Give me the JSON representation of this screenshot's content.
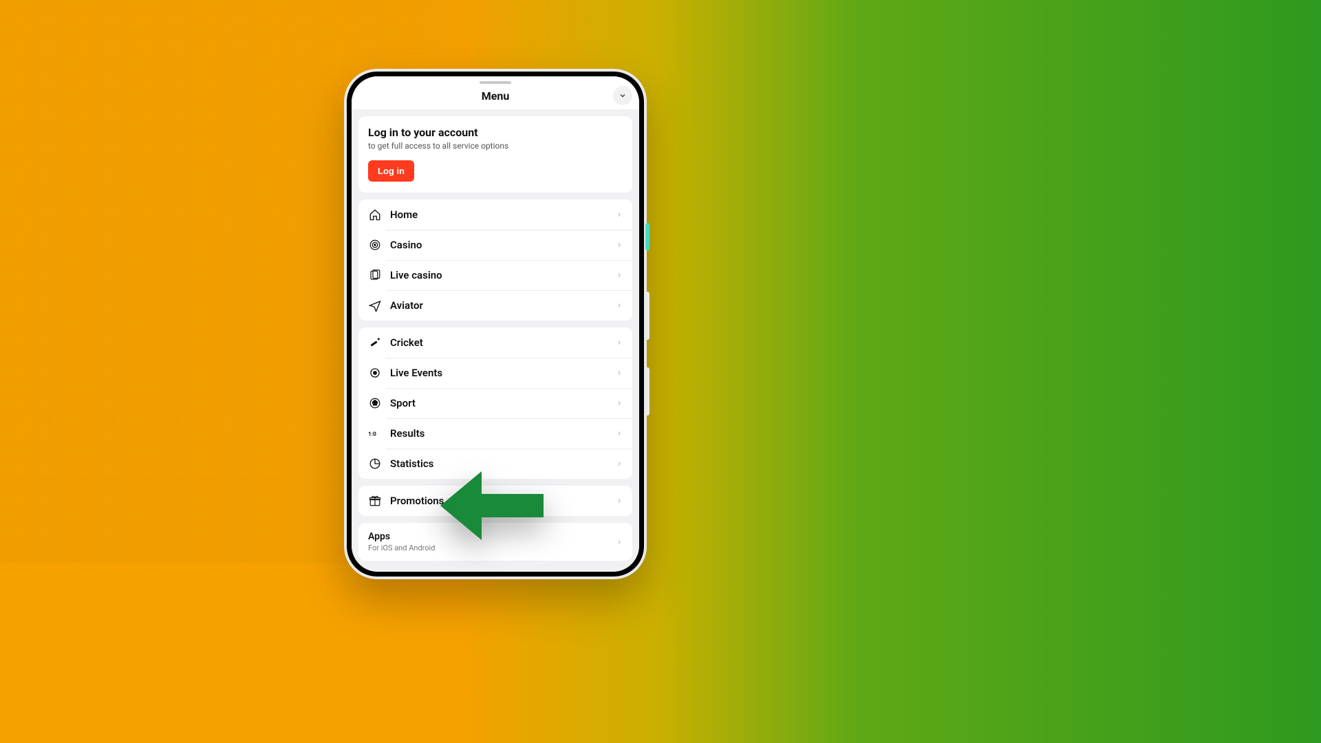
{
  "header": {
    "title": "Menu"
  },
  "login": {
    "title": "Log in to your account",
    "subtitle": "to get full access to all service options",
    "button": "Log in"
  },
  "group1": [
    {
      "icon": "home-icon",
      "label": "Home"
    },
    {
      "icon": "casino-icon",
      "label": "Casino"
    },
    {
      "icon": "livecasino-icon",
      "label": "Live casino"
    },
    {
      "icon": "aviator-icon",
      "label": "Aviator"
    }
  ],
  "group2": [
    {
      "icon": "cricket-icon",
      "label": "Cricket"
    },
    {
      "icon": "liveevents-icon",
      "label": "Live Events"
    },
    {
      "icon": "sport-icon",
      "label": "Sport"
    },
    {
      "icon": "results-icon",
      "label": "Results"
    },
    {
      "icon": "statistics-icon",
      "label": "Statistics"
    }
  ],
  "group3": [
    {
      "icon": "promotions-icon",
      "label": "Promotions"
    }
  ],
  "apps": {
    "label": "Apps",
    "subtitle": "For iOS and Android"
  },
  "colors": {
    "accent": "#ff3b1f",
    "arrow": "#188a3a"
  }
}
